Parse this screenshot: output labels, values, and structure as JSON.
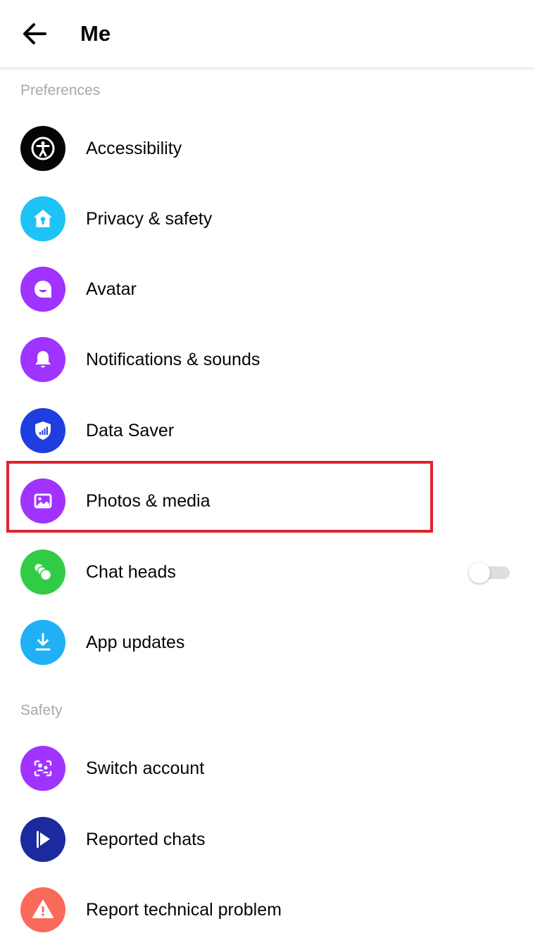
{
  "header": {
    "title": "Me"
  },
  "sections": [
    {
      "label": "Preferences",
      "items": [
        {
          "label": "Accessibility",
          "icon": "accessibility-icon",
          "color": "#050505"
        },
        {
          "label": "Privacy & safety",
          "icon": "privacy-home-lock-icon",
          "color": "#1ec3f5"
        },
        {
          "label": "Avatar",
          "icon": "avatar-face-icon",
          "color": "#a033ff"
        },
        {
          "label": "Notifications & sounds",
          "icon": "bell-icon",
          "color": "#a033ff"
        },
        {
          "label": "Data Saver",
          "icon": "shield-signal-icon",
          "color": "#1f3ee0"
        },
        {
          "label": "Photos & media",
          "icon": "image-icon",
          "color": "#a033ff"
        },
        {
          "label": "Chat heads",
          "icon": "chat-heads-icon",
          "color": "#31cc46",
          "toggle": false
        },
        {
          "label": "App updates",
          "icon": "download-icon",
          "color": "#1fb0f5"
        }
      ]
    },
    {
      "label": "Safety",
      "items": [
        {
          "label": "Switch account",
          "icon": "switch-account-icon",
          "color": "#a033ff"
        },
        {
          "label": "Reported chats",
          "icon": "flag-icon",
          "color": "#1b2a9e"
        },
        {
          "label": "Report technical problem",
          "icon": "warning-icon",
          "color": "#fa6a5a"
        }
      ]
    }
  ]
}
